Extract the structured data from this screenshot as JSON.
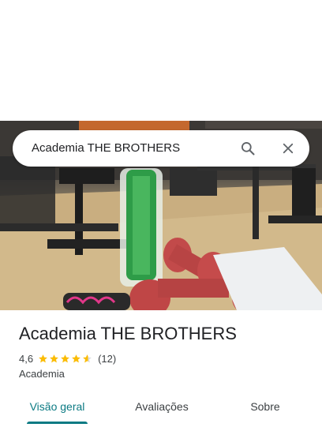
{
  "search": {
    "query": "Academia THE BROTHERS",
    "search_icon": "search-icon",
    "close_icon": "close-icon"
  },
  "hero": {
    "photo_icon": "gym-photo"
  },
  "place": {
    "title": "Academia THE BROTHERS",
    "rating": "4,6",
    "stars": 4.6,
    "review_count": "(12)",
    "category": "Academia"
  },
  "tabs": [
    {
      "label": "Visão geral",
      "active": true
    },
    {
      "label": "Avaliações",
      "active": false
    },
    {
      "label": "Sobre",
      "active": false
    }
  ],
  "colors": {
    "accent": "#0b7a83",
    "star": "#fbbc04"
  }
}
